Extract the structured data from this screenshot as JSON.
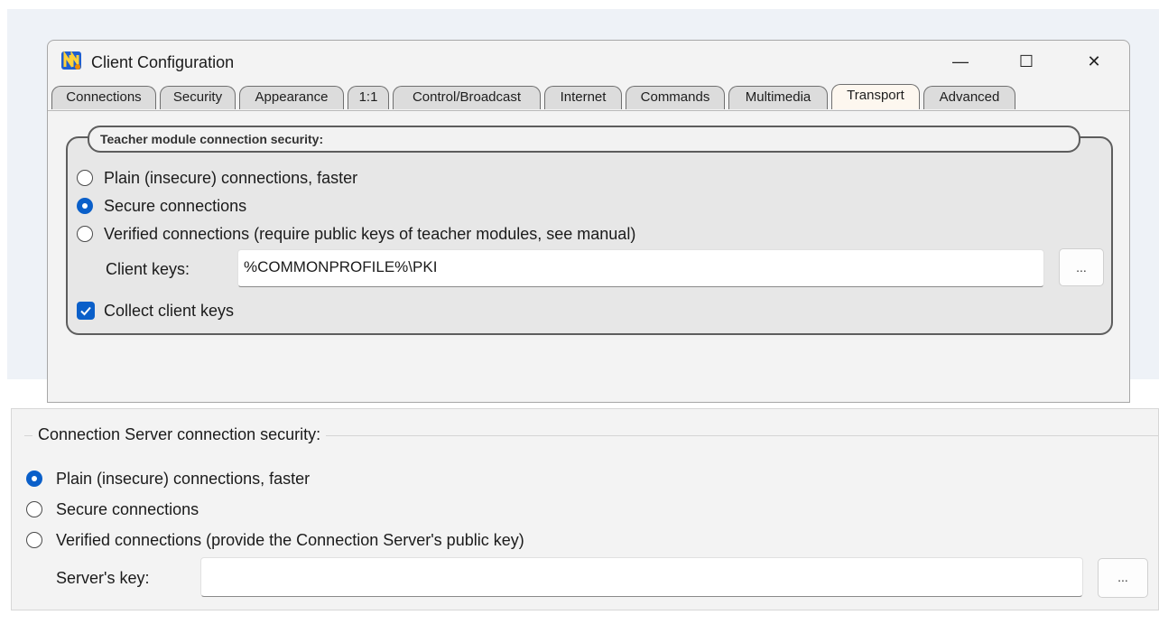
{
  "window": {
    "title": "Client Configuration",
    "app_icon": "netop-app-icon",
    "minimize_glyph": "—",
    "maximize_glyph": "☐",
    "close_glyph": "✕"
  },
  "tabs": [
    {
      "label": "Connections"
    },
    {
      "label": "Security"
    },
    {
      "label": "Appearance"
    },
    {
      "label": "1:1"
    },
    {
      "label": "Control/Broadcast"
    },
    {
      "label": "Internet"
    },
    {
      "label": "Commands"
    },
    {
      "label": "Multimedia"
    },
    {
      "label": "Transport",
      "active": true
    },
    {
      "label": "Advanced"
    }
  ],
  "teacher_security": {
    "caption": "Teacher module connection security:",
    "options": [
      {
        "label": "Plain (insecure) connections, faster",
        "selected": false
      },
      {
        "label": "Secure connections",
        "selected": true
      },
      {
        "label": "Verified connections (require public keys of teacher modules, see manual)",
        "selected": false
      }
    ],
    "client_keys_label": "Client keys:",
    "client_keys_value": "%COMMONPROFILE%\\PKI",
    "browse_label": "...",
    "collect_label": "Collect client keys",
    "collect_checked": true
  },
  "server_security": {
    "caption": "Connection Server connection security:",
    "options": [
      {
        "label": "Plain (insecure) connections, faster",
        "selected": true
      },
      {
        "label": "Secure connections",
        "selected": false
      },
      {
        "label": "Verified connections (provide the Connection Server's public key)",
        "selected": false
      }
    ],
    "server_key_label": "Server's key:",
    "server_key_value": "",
    "browse_label": "..."
  },
  "colors": {
    "accent": "#0a5fc9",
    "active_tab": "#fdf7ef",
    "tab": "#dcdcdc"
  }
}
